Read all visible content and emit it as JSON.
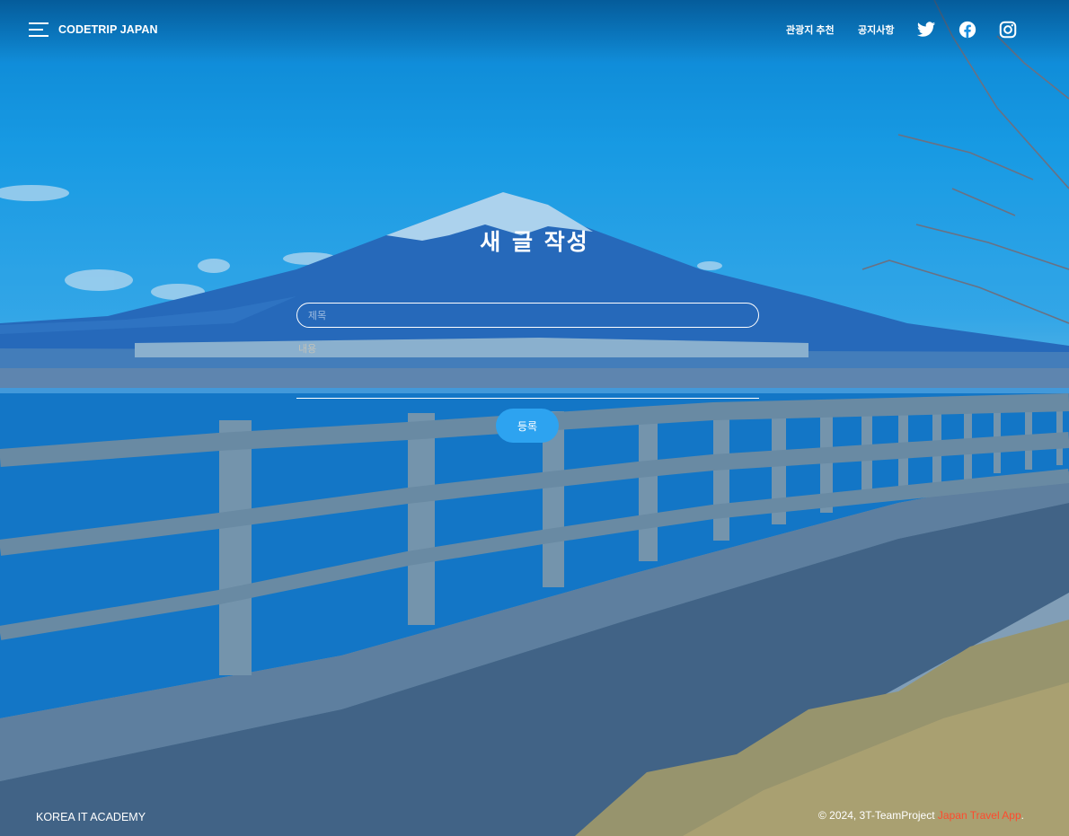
{
  "header": {
    "brand": "CODETRIP JAPAN",
    "nav": [
      {
        "label": "관광지 추천"
      },
      {
        "label": "공지사항"
      }
    ],
    "social": [
      "twitter-icon",
      "facebook-icon",
      "instagram-icon"
    ]
  },
  "form": {
    "title": "새 글 작성",
    "title_placeholder": "제목",
    "content_placeholder": "내용",
    "submit_label": "등록"
  },
  "footer": {
    "left": "KOREA IT ACADEMY",
    "copyright": "© 2024, 3T-TeamProject",
    "app_name": "Japan Travel App",
    "period": "."
  },
  "colors": {
    "sky": "#1aa2ea",
    "button": "#2da3f0",
    "accent": "#ff4a2e"
  }
}
